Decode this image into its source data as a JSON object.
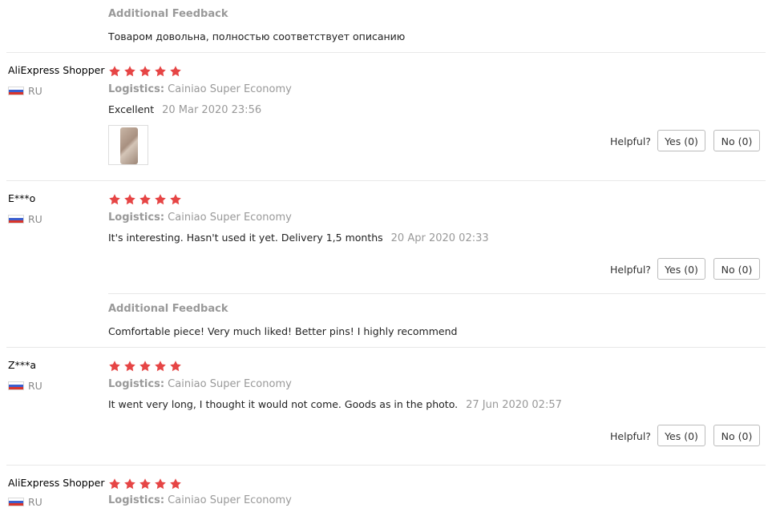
{
  "rating_color": "#e64545",
  "top_feedback": {
    "label": "Additional Feedback",
    "text": "Товаром довольна, полностью соответствует описанию"
  },
  "reviews": [
    {
      "name": "AliExpress Shopper",
      "country": "RU",
      "stars": 5,
      "logistics_label": "Logistics:",
      "logistics_value": "Cainiao Super Economy",
      "text": "Excellent",
      "date": "20 Mar 2020 23:56",
      "helpful_label": "Helpful?",
      "yes_label": "Yes (0)",
      "no_label": "No (0)"
    },
    {
      "name": "E***o",
      "country": "RU",
      "stars": 5,
      "logistics_label": "Logistics:",
      "logistics_value": "Cainiao Super Economy",
      "text": "It's interesting. Hasn't used it yet. Delivery 1,5 months",
      "date": "20 Apr 2020 02:33",
      "helpful_label": "Helpful?",
      "yes_label": "Yes (0)",
      "no_label": "No (0)",
      "additional_label": "Additional Feedback",
      "additional_text": "Comfortable piece! Very much liked! Better pins! I highly recommend"
    },
    {
      "name": "Z***a",
      "country": "RU",
      "stars": 5,
      "logistics_label": "Logistics:",
      "logistics_value": "Cainiao Super Economy",
      "text": "It went very long, I thought it would not come. Goods as in the photo.",
      "date": "27 Jun 2020 02:57",
      "helpful_label": "Helpful?",
      "yes_label": "Yes (0)",
      "no_label": "No (0)"
    },
    {
      "name": "AliExpress Shopper",
      "country": "RU",
      "stars": 5,
      "logistics_label": "Logistics:",
      "logistics_value": "Cainiao Super Economy"
    }
  ]
}
